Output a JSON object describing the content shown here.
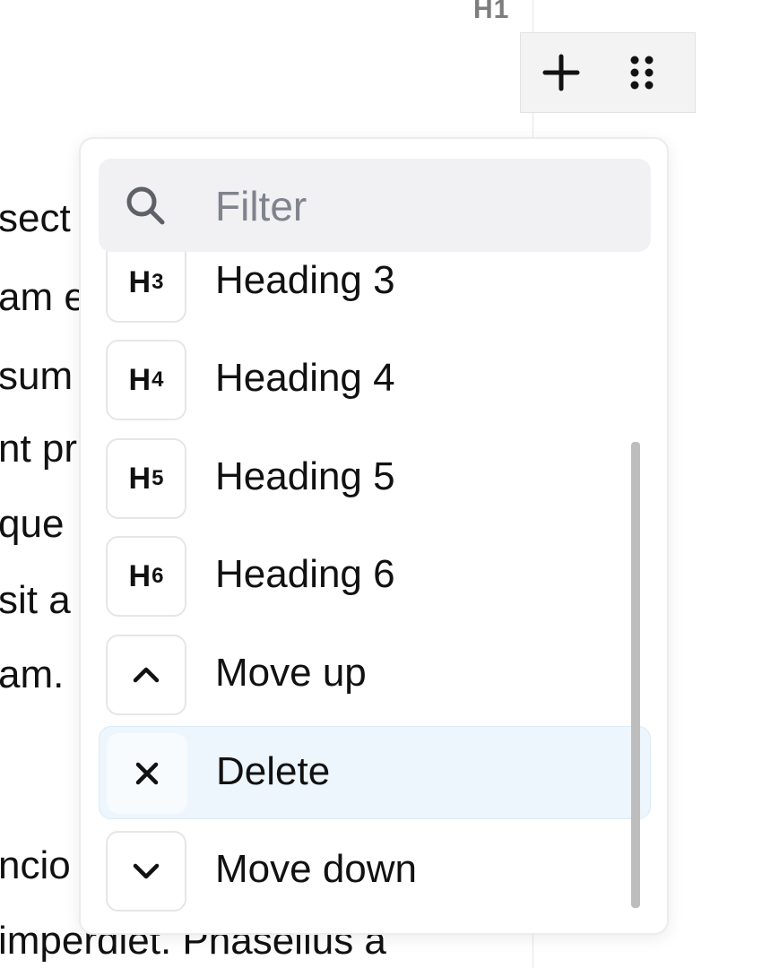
{
  "background_text": [
    "sect",
    "am e",
    "sum",
    "nt pr",
    "que",
    "sit a",
    "am.",
    "ncio",
    "imperdiet. Phasellus a"
  ],
  "block_toolbar": {
    "heading_badge": "H1",
    "add_icon": "plus-icon",
    "drag_icon": "drag-handle-icon"
  },
  "menu": {
    "filter": {
      "placeholder": "Filter",
      "value": "",
      "icon": "search-icon"
    },
    "items": [
      {
        "icon_text": "H",
        "icon_level": "3",
        "label": "Heading 3"
      },
      {
        "icon_text": "H",
        "icon_level": "4",
        "label": "Heading 4"
      },
      {
        "icon_text": "H",
        "icon_level": "5",
        "label": "Heading 5"
      },
      {
        "icon_text": "H",
        "icon_level": "6",
        "label": "Heading 6"
      },
      {
        "icon": "chevron-up-icon",
        "label": "Move up"
      },
      {
        "icon": "close-icon",
        "label": "Delete",
        "active": true
      },
      {
        "icon": "chevron-down-icon",
        "label": "Move down"
      }
    ]
  },
  "colors": {
    "accent_highlight": "#eef6fd",
    "filter_background": "#f1f1f3",
    "placeholder": "#80838c"
  }
}
